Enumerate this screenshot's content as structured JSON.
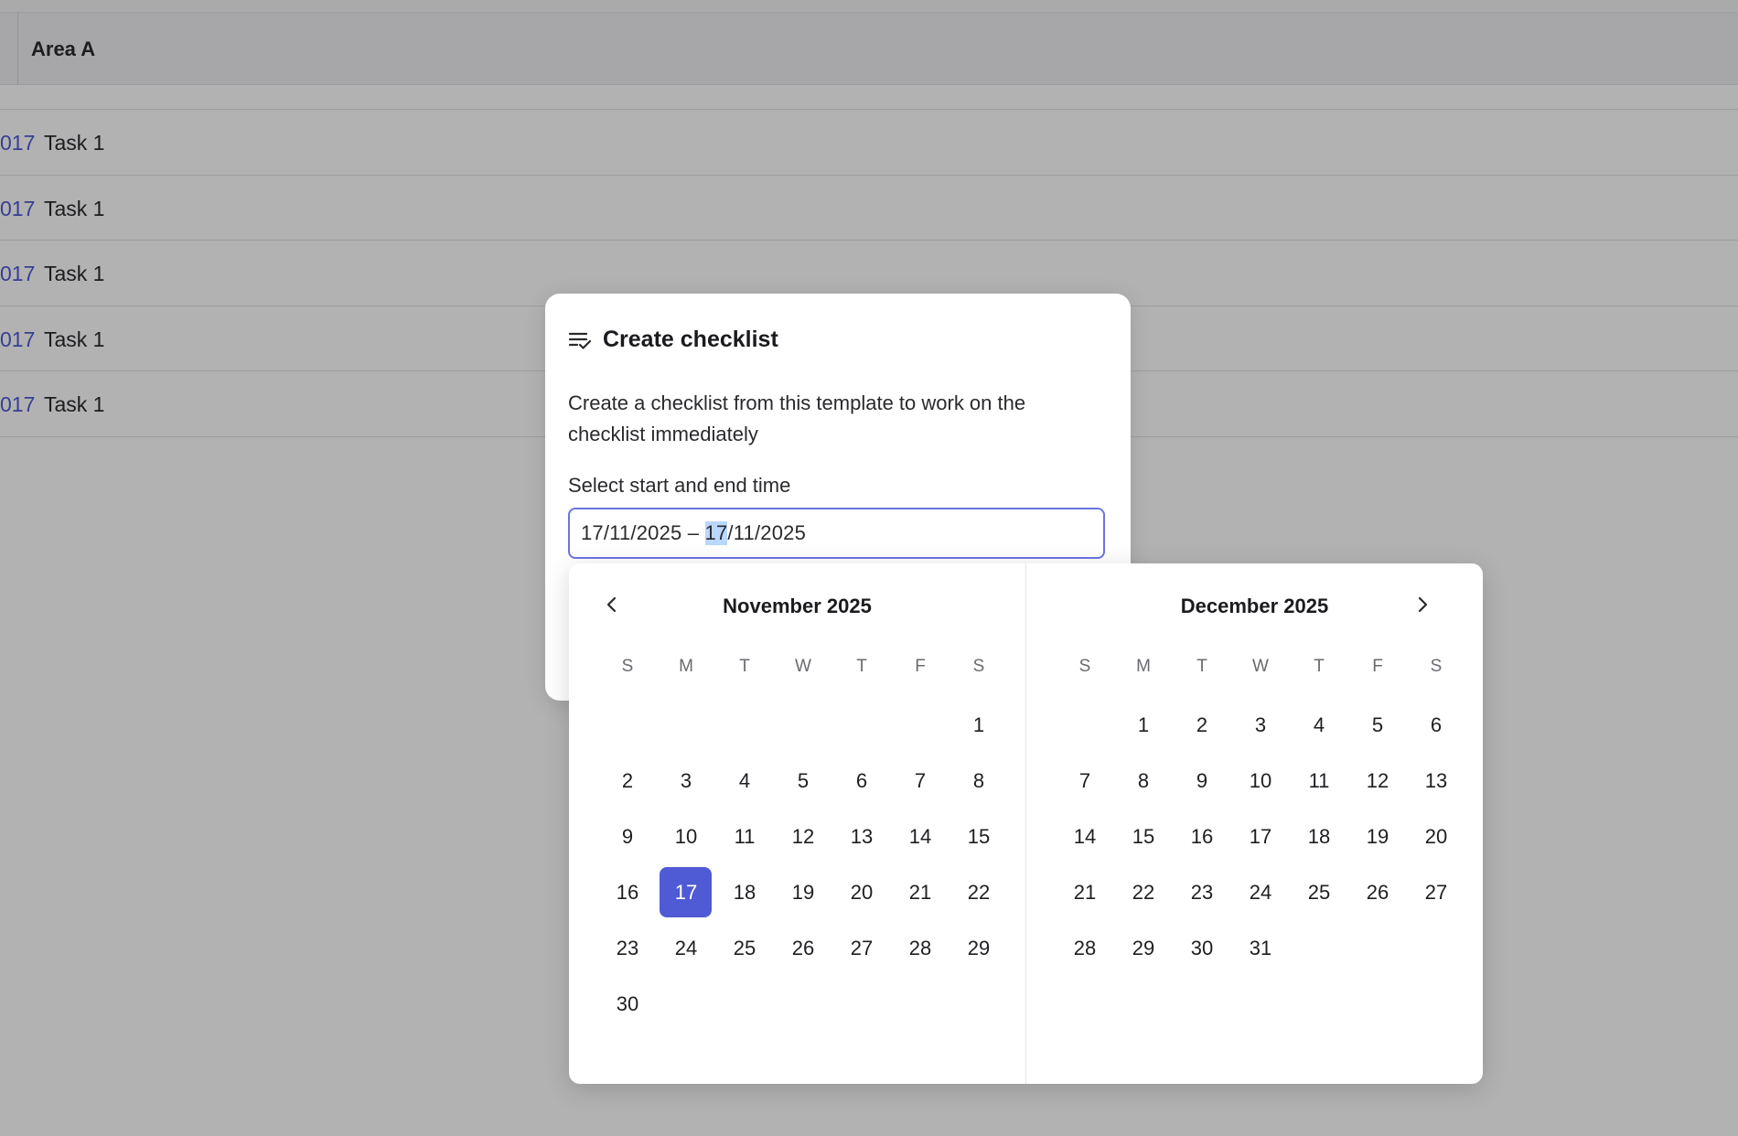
{
  "background": {
    "header_title": "Area A",
    "rows": [
      {
        "id": "017",
        "name": "Task 1"
      },
      {
        "id": "017",
        "name": "Task 1"
      },
      {
        "id": "017",
        "name": "Task 1"
      },
      {
        "id": "017",
        "name": "Task 1"
      },
      {
        "id": "017",
        "name": "Task 1"
      }
    ]
  },
  "modal": {
    "icon": "checklist-icon",
    "title": "Create checklist",
    "description": "Create a checklist from this template to work on the checklist immediately",
    "field_label": "Select start and end time",
    "date_range": {
      "prefix": "17/11/2025 – ",
      "selected_segment": "17",
      "suffix": "/11/2025"
    }
  },
  "calendar": {
    "weekday_labels": [
      "S",
      "M",
      "T",
      "W",
      "T",
      "F",
      "S"
    ],
    "months": [
      {
        "title": "November 2025",
        "first_weekday": 6,
        "days": 30,
        "selected_day": 17
      },
      {
        "title": "December 2025",
        "first_weekday": 1,
        "days": 31,
        "selected_day": null
      }
    ],
    "prev_icon": "chevron-left-icon",
    "next_icon": "chevron-right-icon",
    "accent_color": "#4f5bd5"
  }
}
